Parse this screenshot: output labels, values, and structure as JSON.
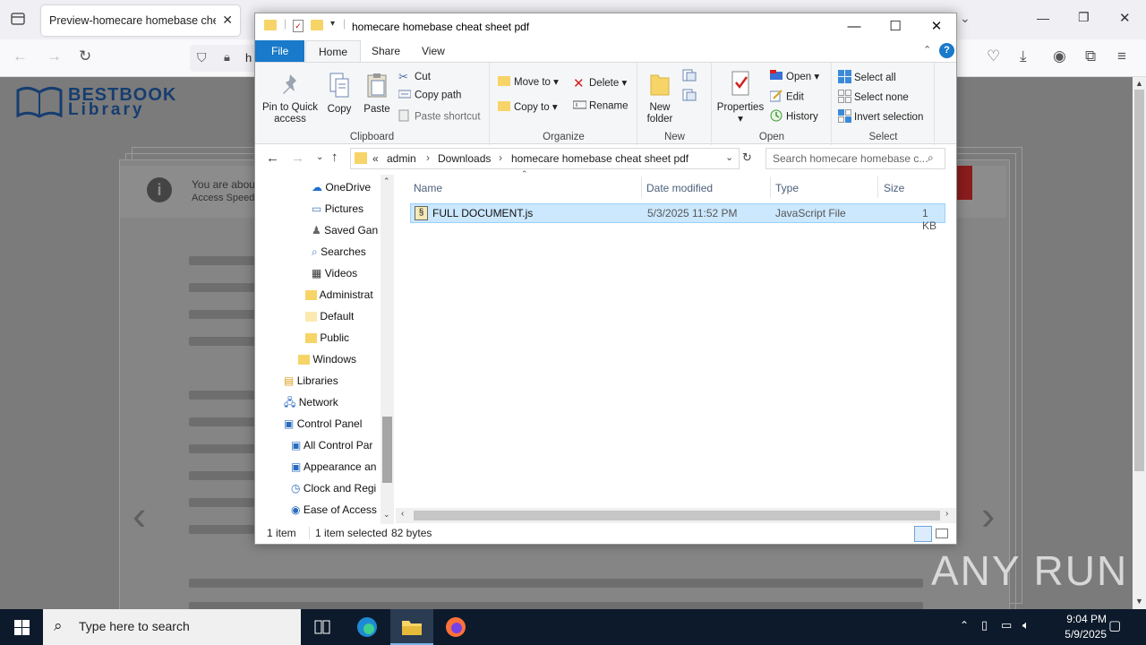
{
  "browser": {
    "tab_title": "Preview-homecare homebase cheat",
    "url_partial": "h"
  },
  "site": {
    "logo_line1": "BESTBOOK",
    "logo_line2": "Library",
    "notice_line1": "You are abou",
    "notice_line2": "Access Speed"
  },
  "explorer": {
    "title": "homecare homebase cheat sheet pdf",
    "ribbon_tabs": [
      "File",
      "Home",
      "Share",
      "View"
    ],
    "clipboard": {
      "pin": "Pin to Quick access",
      "copy": "Copy",
      "paste": "Paste",
      "cut": "Cut",
      "copy_path": "Copy path",
      "paste_shortcut": "Paste shortcut",
      "label": "Clipboard"
    },
    "organize": {
      "move_to": "Move to",
      "copy_to": "Copy to",
      "delete": "Delete",
      "rename": "Rename",
      "label": "Organize"
    },
    "new": {
      "new_folder": "New folder",
      "label": "New"
    },
    "open": {
      "properties": "Properties",
      "open": "Open",
      "edit": "Edit",
      "history": "History",
      "label": "Open"
    },
    "select": {
      "select_all": "Select all",
      "select_none": "Select none",
      "invert": "Invert selection",
      "label": "Select"
    },
    "address": {
      "chevrons": "«",
      "crumbs": [
        "admin",
        "Downloads",
        "homecare homebase cheat sheet pdf"
      ]
    },
    "search_placeholder": "Search homecare homebase c...",
    "nav_items": [
      "OneDrive",
      "Pictures",
      "Saved Gan",
      "Searches",
      "Videos",
      "Administrat",
      "Default",
      "Public",
      "Windows",
      "Libraries",
      "Network",
      "Control Panel",
      "All Control Par",
      "Appearance an",
      "Clock and Regi",
      "Ease of Access"
    ],
    "columns": [
      "Name",
      "Date modified",
      "Type",
      "Size"
    ],
    "files": [
      {
        "name": "FULL DOCUMENT.js",
        "date": "5/3/2025 11:52 PM",
        "type": "JavaScript File",
        "size": "1 KB"
      }
    ],
    "status": {
      "count": "1 item",
      "selected": "1 item selected",
      "bytes": "82 bytes"
    }
  },
  "taskbar": {
    "search_placeholder": "Type here to search",
    "time": "9:04 PM",
    "date": "5/9/2025"
  },
  "watermark": "ANY RUN"
}
